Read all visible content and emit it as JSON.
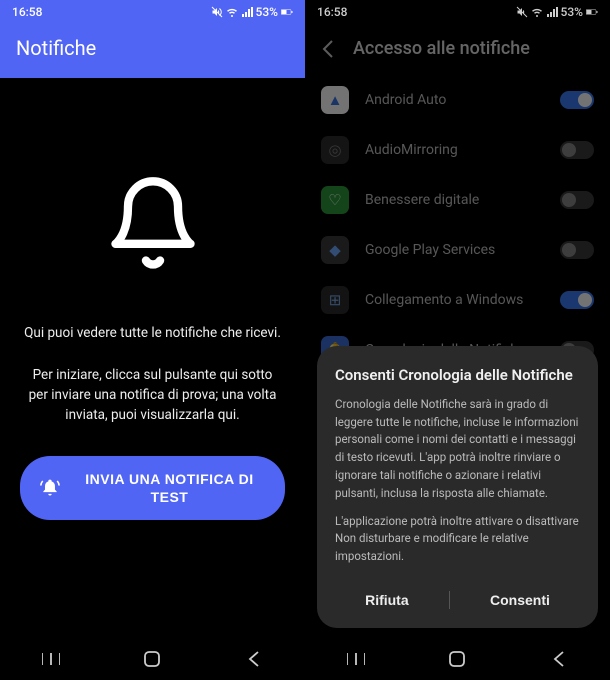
{
  "status": {
    "time": "16:58",
    "battery": "53%"
  },
  "left": {
    "header_title": "Notifiche",
    "intro": "Qui puoi vedere tutte le notifiche che ricevi.",
    "instruction": "Per iniziare, clicca sul pulsante qui sotto per inviare una notifica di prova; una volta inviata, puoi visualizzarla qui.",
    "button_label": "INVIA UNA NOTIFICA DI TEST"
  },
  "right": {
    "header_title": "Accesso alle notifiche",
    "apps": [
      {
        "name": "Android Auto",
        "on": true,
        "icon_bg": "#ffffff",
        "icon_fg": "#3b77e0",
        "glyph": "▲"
      },
      {
        "name": "AudioMirroring",
        "on": false,
        "icon_bg": "#2d2d2d",
        "icon_fg": "#7a7a7a",
        "glyph": "◎"
      },
      {
        "name": "Benessere digitale",
        "on": false,
        "icon_bg": "#2e9a3b",
        "icon_fg": "#ffffff",
        "glyph": "♡"
      },
      {
        "name": "Google Play Services",
        "on": false,
        "icon_bg": "#3a3a3a",
        "icon_fg": "#6fa8ff",
        "glyph": "◆"
      },
      {
        "name": "Collegamento a Windows",
        "on": true,
        "icon_bg": "#2a2a2a",
        "icon_fg": "#7aa8e8",
        "glyph": "⊞"
      },
      {
        "name": "Cronologia delle Notifiche",
        "on": false,
        "icon_bg": "#3a6dd8",
        "icon_fg": "#cfe0ff",
        "glyph": "🔔"
      }
    ]
  },
  "dialog": {
    "title": "Consenti Cronologia delle Notifiche",
    "body1": "Cronologia delle Notifiche sarà in grado di leggere tutte le notifiche, incluse le informazioni personali come i nomi dei contatti e i messaggi di testo ricevuti. L'app potrà inoltre rinviare o ignorare tali notifiche o azionare i relativi pulsanti, inclusa la risposta alle chiamate.",
    "body2": "L'applicazione potrà inoltre attivare o disattivare Non disturbare e modificare le relative impostazioni.",
    "deny": "Rifiuta",
    "allow": "Consenti"
  }
}
